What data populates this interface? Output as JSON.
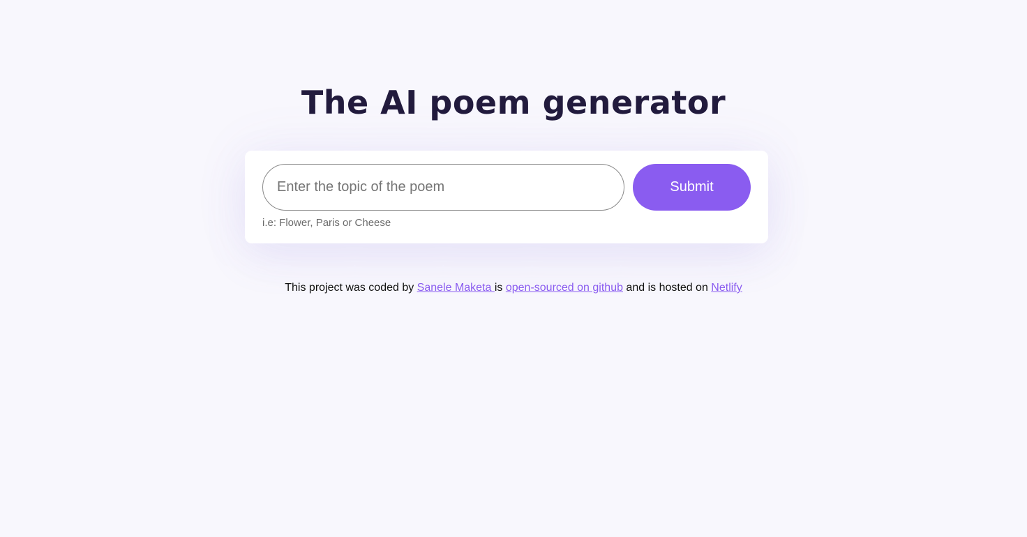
{
  "header": {
    "title": "The AI poem generator"
  },
  "form": {
    "input_placeholder": "Enter the topic of the poem",
    "input_value": "",
    "submit_label": "Submit",
    "hint": "i.e: Flower, Paris or Cheese"
  },
  "footer": {
    "text_before_author": "This project was coded by ",
    "author_link": "Sanele Maketa ",
    "text_is": " is ",
    "github_link": "open-sourced on github",
    "text_hosted": " and is hosted on ",
    "netlify_link": "Netlify"
  },
  "colors": {
    "accent": "#8a5cf0",
    "title": "#221b3d",
    "background": "#f8f7fd"
  }
}
